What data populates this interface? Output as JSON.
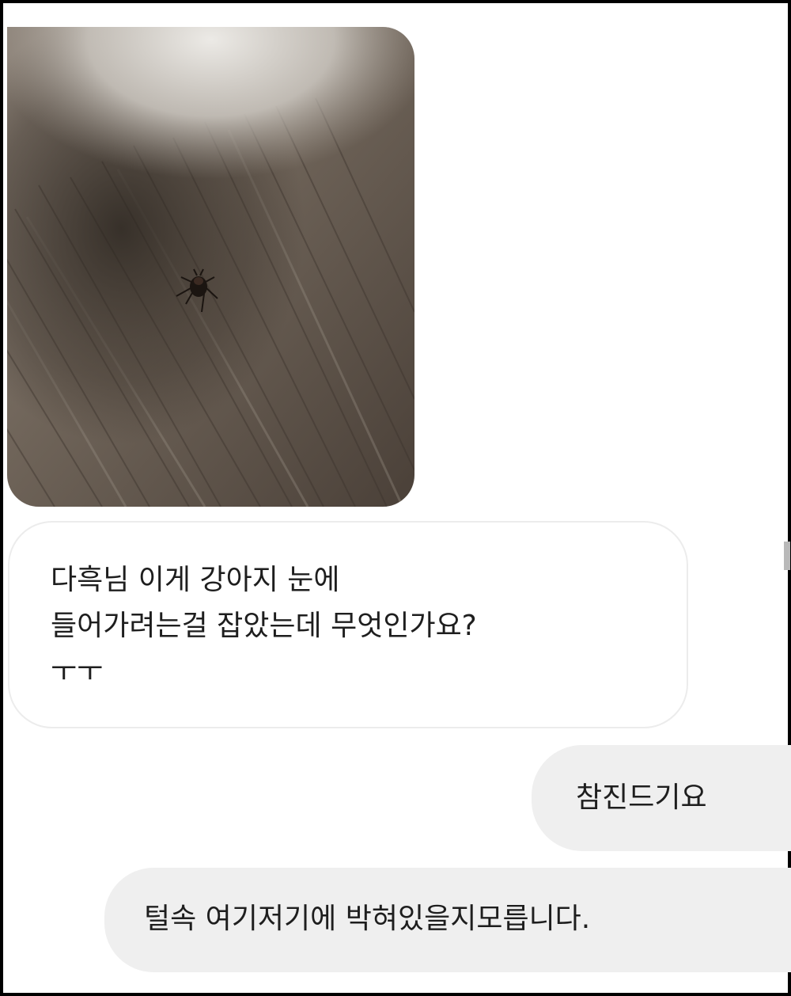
{
  "chat": {
    "photo": {
      "icon": "tick-photo"
    },
    "received_message": {
      "lines": [
        "다흑님 이게 강아지 눈에",
        "들어가려는걸 잡았는데 무엇인가요?",
        "ㅜㅜ"
      ]
    },
    "sent_messages": [
      {
        "text": "참진드기요"
      },
      {
        "text": "털속 여기저기에 박혀있을지모릅니다."
      }
    ]
  },
  "colors": {
    "received_bubble_bg": "#ffffff",
    "received_bubble_border": "#ececec",
    "sent_bubble_bg": "#efefef",
    "text": "#1e1e1e"
  }
}
